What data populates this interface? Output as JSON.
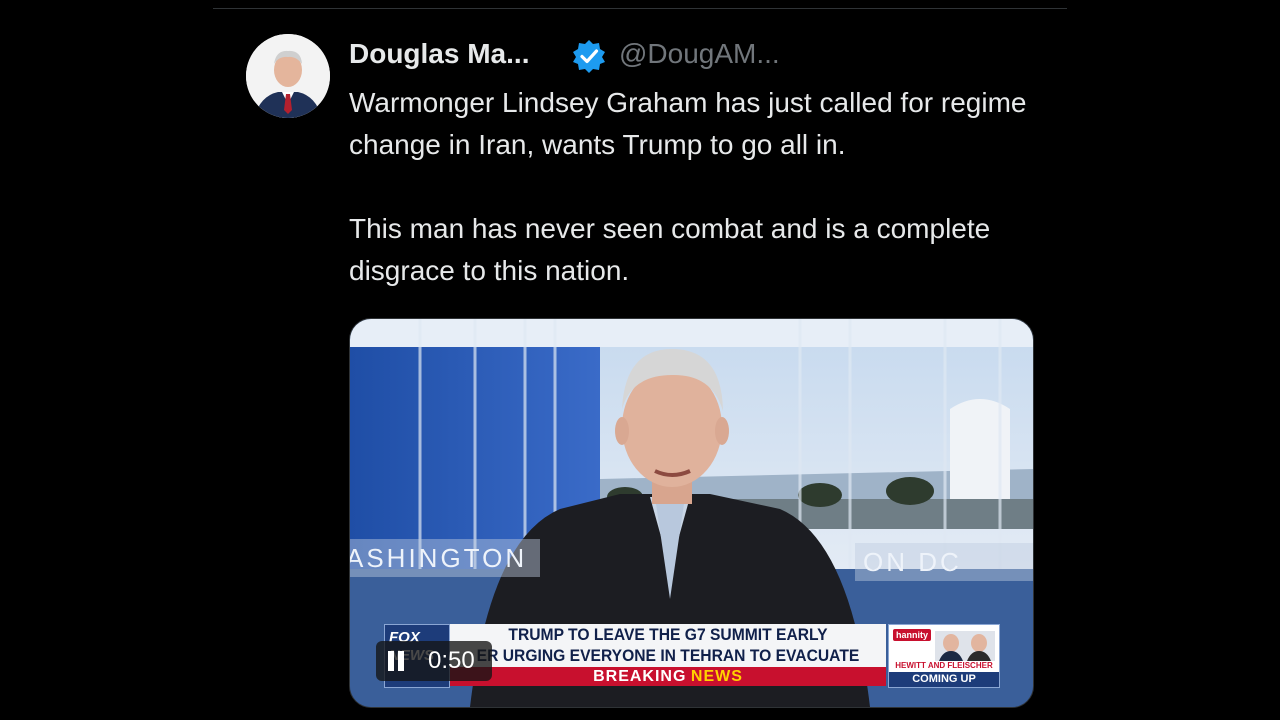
{
  "post": {
    "author_name": "Douglas Ma...",
    "handle": "@DougAM...",
    "text_1": "Warmonger Lindsey Graham has just called for regime change in Iran, wants Trump to go all in.",
    "text_2": "This man has never seen combat and is a complete disgrace to this nation."
  },
  "video": {
    "time": "0:50",
    "location_left": "ASHINGTON",
    "location_right": "ON DC",
    "network_logo": "FOX NEWS",
    "chyron_line_1": "TRUMP TO LEAVE THE G7 SUMMIT EARLY",
    "chyron_line_2": "ER URGING EVERYONE IN TEHRAN TO EVACUATE",
    "breaking_1": "BREAKING",
    "breaking_2": "NEWS",
    "upnext_show": "hannity",
    "upnext_names": "HEWITT AND FLEISCHER",
    "upnext_coming": "COMING UP"
  },
  "icons": {
    "verified": "verified-badge-icon",
    "pause": "pause-icon"
  },
  "colors": {
    "background": "#000000",
    "text": "#e7e9ea",
    "muted": "#71767b",
    "verified": "#1d9bf0",
    "breaking_red": "#c8102e",
    "news_yellow": "#ffd200"
  }
}
